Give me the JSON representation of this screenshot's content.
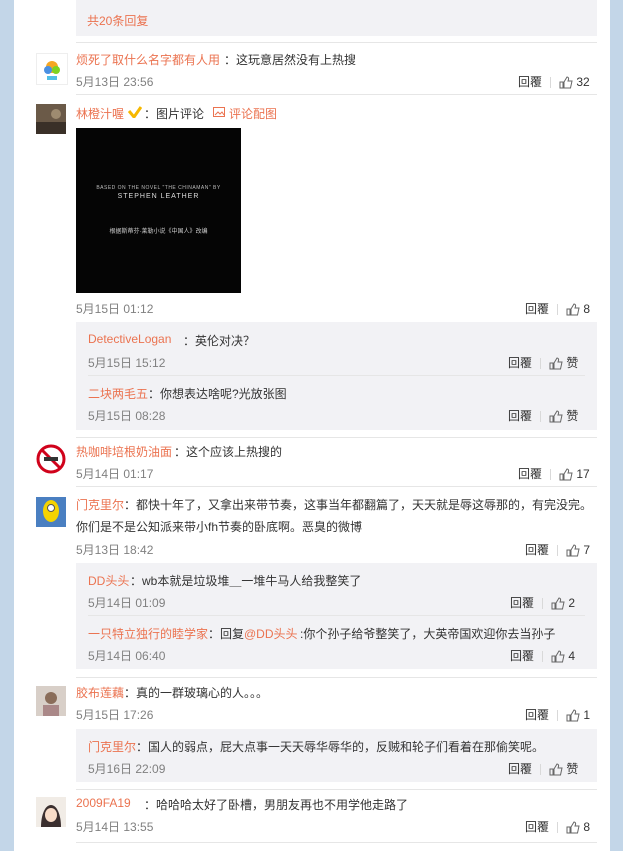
{
  "page": {
    "reply_label": "回覆"
  },
  "thread_top": {
    "more_replies": "共20条回复"
  },
  "comments": [
    {
      "user": "烦死了取什么名字都有人用",
      "text": "：这玩意居然没有上热搜",
      "time": "5月13日 23:56",
      "likes": "32"
    },
    {
      "user": "林橙汁喔",
      "text": "：图片评论",
      "pic_link": "评论配图",
      "time": "5月15日 01:12",
      "likes": "8",
      "image_text": {
        "line1": "BASED ON THE NOVEL \"THE CHINAMAN\" BY",
        "line2": "STEPHEN LEATHER",
        "line3": "根据斯蒂芬·莱勒小说《中国人》改编"
      },
      "replies": [
        {
          "user": "DetectiveLogan",
          "text": "：英伦对决？",
          "time": "5月15日 15:12",
          "likes": "赞"
        },
        {
          "user": "二块两毛五",
          "text": "：你想表达啥呢?光放张图",
          "time": "5月15日 08:28",
          "likes": "赞"
        }
      ]
    },
    {
      "user": "热咖啡培根奶油面",
      "text": "：这个应该上热搜的",
      "time": "5月14日 01:17",
      "likes": "17"
    },
    {
      "user": "门克里尔",
      "text": "：都快十年了，又拿出来带节奏，这事当年都翻篇了，天天就是辱这辱那的，有完没完。",
      "text2": "你们是不是公知派来带小fh节奏的卧底啊。恶臭的微博",
      "time": "5月13日 18:42",
      "likes": "7",
      "replies": [
        {
          "user": "DD头头",
          "text": "：wb本就是垃圾堆＿一堆牛马人给我整笑了",
          "time": "5月14日 01:09",
          "likes": "2"
        },
        {
          "user": "一只特立独行的睦学家",
          "text": "：回复",
          "mention": "@DD头头",
          "text_after": ":你个孙子给爷整笑了，大英帝国欢迎你去当孙子",
          "time": "5月14日 06:40",
          "likes": "4"
        }
      ]
    },
    {
      "user": "胶布莲藕",
      "text": "：真的一群玻璃心的人。。。",
      "time": "5月15日 17:26",
      "likes": "1",
      "replies": [
        {
          "user": "门克里尔",
          "text": "：国人的弱点，屁大点事一天天辱华辱华的，反贼和轮子们看着在那偷笑呢。",
          "time": "5月16日 22:09",
          "likes": "赞"
        }
      ]
    },
    {
      "user": "2009FA19",
      "text": "：哈哈哈太好了卧槽，男朋友再也不用学他走路了",
      "time": "5月14日 13:55",
      "likes": "8"
    }
  ],
  "colors": {
    "name": "#eb7350",
    "meta": "#808080",
    "reply_bg": "#f2f2f5",
    "page_bg": "#c3d6e8",
    "badge": "#f6b800"
  }
}
